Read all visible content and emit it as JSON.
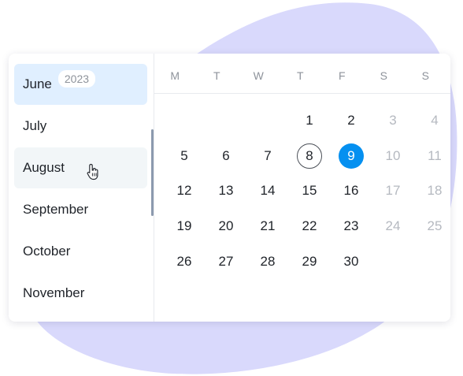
{
  "year": "2023",
  "months": [
    "June",
    "July",
    "August",
    "September",
    "October",
    "November"
  ],
  "weekdays": [
    "M",
    "T",
    "W",
    "T",
    "F",
    "S",
    "S"
  ],
  "weeks": [
    [
      "",
      "",
      "",
      "1",
      "2",
      "3",
      "4"
    ],
    [
      "5",
      "6",
      "7",
      "8",
      "9",
      "10",
      "11"
    ],
    [
      "12",
      "13",
      "14",
      "15",
      "16",
      "17",
      "18"
    ],
    [
      "19",
      "20",
      "21",
      "22",
      "23",
      "24",
      "25"
    ],
    [
      "26",
      "27",
      "28",
      "29",
      "30",
      "",
      ""
    ]
  ],
  "active_month": "June",
  "hovered_month": "August",
  "today": "8",
  "selected_day": "9",
  "colors": {
    "selected": "#0590f0",
    "active_month_bg": "#e0efff",
    "blob": "#d9d9fc",
    "muted_text": "#b5b9c0"
  },
  "icons": {
    "cursor": "hand-pointer-icon"
  }
}
